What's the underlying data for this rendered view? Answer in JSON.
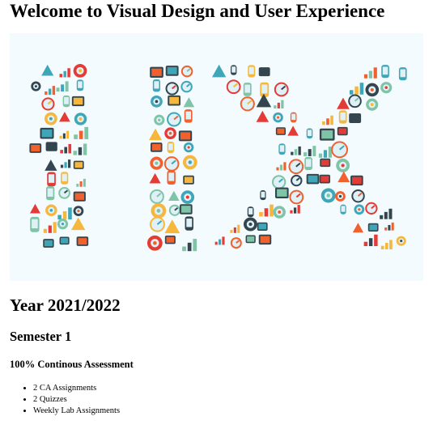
{
  "page": {
    "heading": "Welcome to Visual Design and User Experience",
    "hero": {
      "alt": "UX",
      "colors": {
        "background": "#f4fbfe",
        "teal": "#3fa6b8",
        "orange": "#f0612e",
        "yellow": "#f6b73c",
        "red": "#e53b36",
        "dark": "#33464f",
        "light": "#dff1f6",
        "green": "#7fc4a7"
      }
    },
    "year": "Year 2021/2022",
    "semester": "Semester 1",
    "assessment_heading": "100% Continous Assessment",
    "assessment_items": [
      "2 CA Assignments",
      "2 Quizzes",
      "Weekly Lab Assignments"
    ]
  }
}
